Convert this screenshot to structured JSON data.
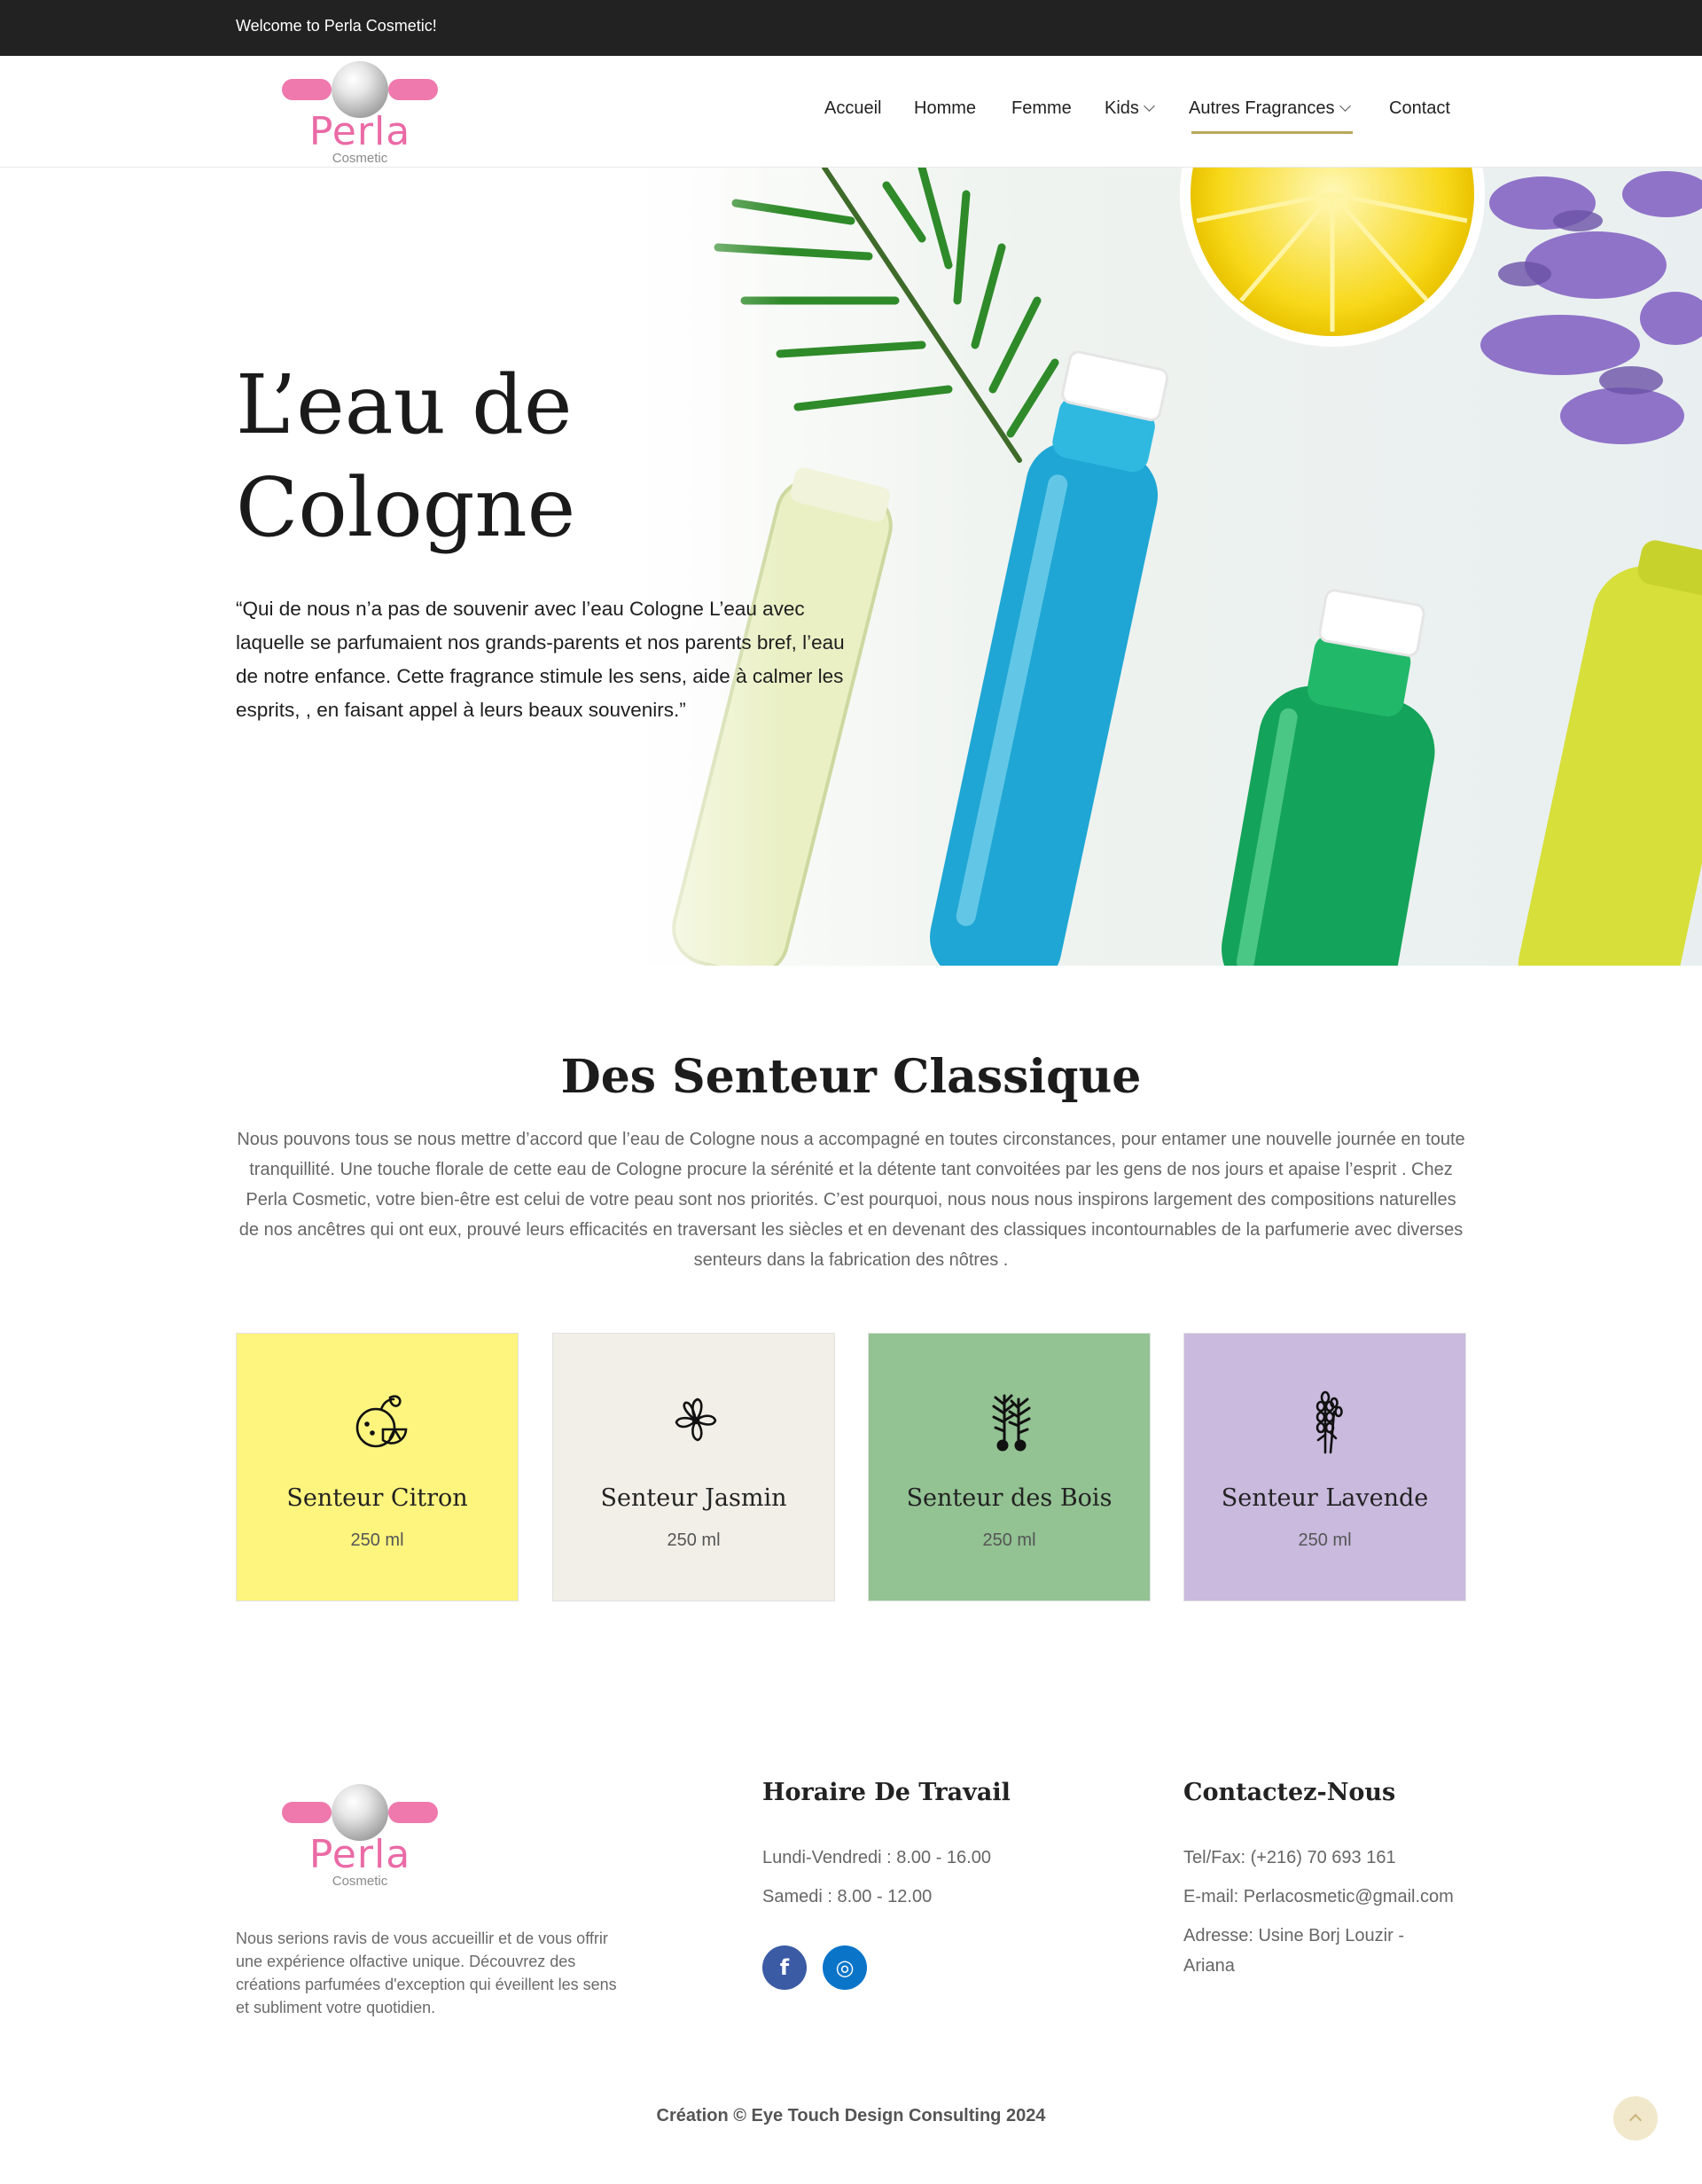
{
  "topbar": {
    "welcome": "Welcome to Perla Cosmetic!"
  },
  "brand": {
    "name": "Perla",
    "tagline": "Cosmetic",
    "pink": "#ef78ad",
    "gold": "#b9a75a"
  },
  "nav": {
    "items": [
      {
        "label": "Accueil",
        "dropdown": false
      },
      {
        "label": "Homme",
        "dropdown": false
      },
      {
        "label": "Femme",
        "dropdown": false
      },
      {
        "label": "Kids",
        "dropdown": true
      },
      {
        "label": "Autres Fragrances",
        "dropdown": true,
        "active": true
      },
      {
        "label": "Contact",
        "dropdown": false
      }
    ]
  },
  "hero": {
    "title_line1": "L’eau de",
    "title_line2": "Cologne",
    "quote": "“Qui de nous n’a pas de souvenir avec l’eau Cologne L’eau avec laquelle se parfumaient nos grands-parents et nos parents bref, l’eau de notre enfance. Cette fragrance stimule les sens, aide à calmer les esprits, , en faisant appel à leurs beaux souvenirs.”"
  },
  "classic": {
    "title": "Des Senteur Classique",
    "text": "Nous pouvons tous se nous mettre d’accord que l’eau de Cologne nous a accompagné en toutes circonstances, pour entamer une nouvelle journée en toute tranquillité. Une touche florale de cette eau de Cologne procure la sérénité et la détente tant convoitées par les gens de nos jours et apaise l’esprit . Chez Perla Cosmetic, votre bien-être est celui de votre peau sont nos priorités. C’est pourquoi, nous nous nous inspirons largement des compositions naturelles de nos ancêtres qui ont eux, prouvé leurs efficacités en traversant les siècles et en devenant des classiques incontournables de la parfumerie avec diverses senteurs dans la fabrication des nôtres .",
    "cards": [
      {
        "title": "Senteur Citron",
        "volume": "250 ml",
        "icon": "lemon-icon",
        "color": "#fdf57e"
      },
      {
        "title": "Senteur Jasmin",
        "volume": "250 ml",
        "icon": "jasmine-flower-icon",
        "color": "#f1efe8"
      },
      {
        "title": "Senteur des Bois",
        "volume": "250 ml",
        "icon": "pine-branch-icon",
        "color": "#93c293"
      },
      {
        "title": "Senteur Lavende",
        "volume": "250 ml",
        "icon": "lavender-icon",
        "color": "#c9bade"
      }
    ]
  },
  "footer": {
    "about": "Nous serions ravis de vous accueillir et de vous offrir une expérience olfactive unique. Découvrez des créations parfumées d'exception qui éveillent les sens et subliment votre quotidien.",
    "hours": {
      "title": "Horaire De Travail",
      "weekdays": "Lundi-Vendredi : 8.00 - 16.00",
      "saturday": "Samedi : 8.00 - 12.00"
    },
    "social": {
      "facebook_icon": "facebook-icon",
      "instagram_icon": "instagram-icon",
      "facebook_glyph": "f",
      "instagram_glyph": "◎"
    },
    "contact": {
      "title": "Contactez-Nous",
      "phone": "Tel/Fax: (+216) 70 693 161",
      "email": "E-mail: Perlacosmetic@gmail.com",
      "address_line1": "Adresse: Usine Borj Louzir -",
      "address_line2": "Ariana"
    },
    "copyright": "Création © Eye Touch Design Consulting 2024"
  }
}
